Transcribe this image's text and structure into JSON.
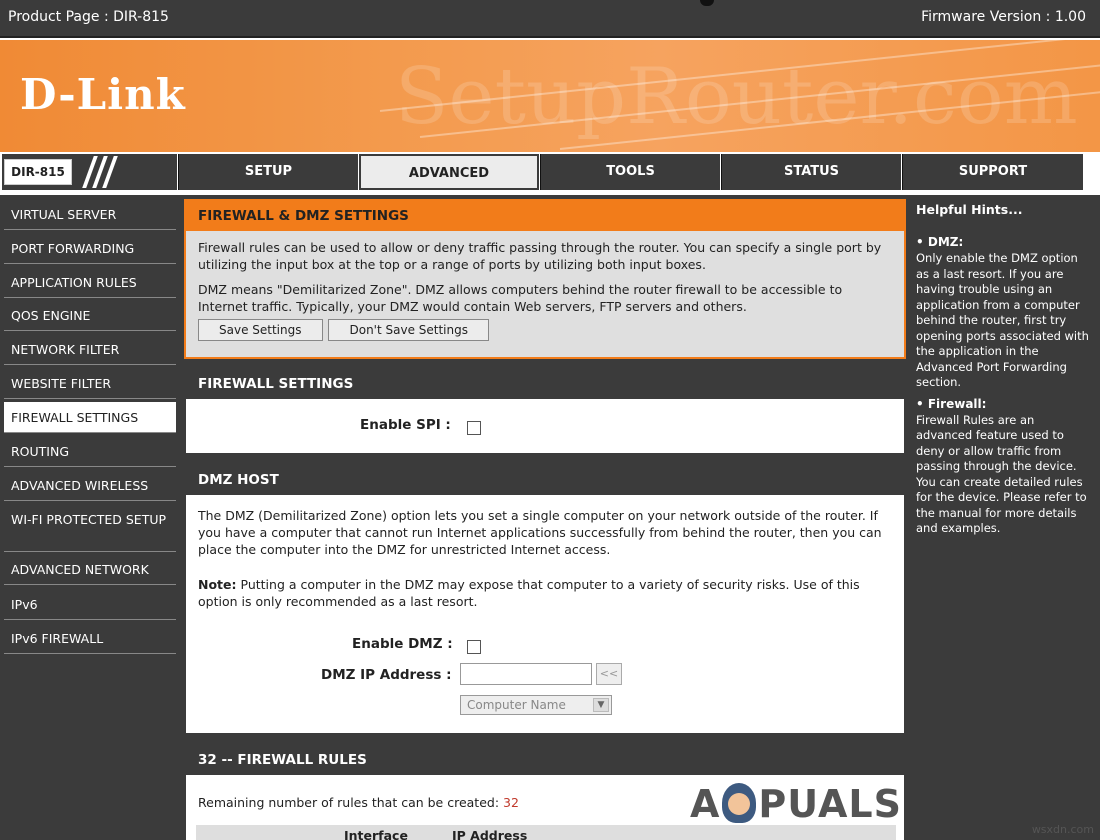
{
  "topbar": {
    "product": "Product Page : DIR-815",
    "firmware": "Firmware Version : 1.00"
  },
  "banner": {
    "logo": "D-Link",
    "watermark": "SetupRouter.com"
  },
  "model": "DIR-815",
  "nav": [
    {
      "label": "SETUP",
      "active": false
    },
    {
      "label": "ADVANCED",
      "active": true
    },
    {
      "label": "TOOLS",
      "active": false
    },
    {
      "label": "STATUS",
      "active": false
    },
    {
      "label": "SUPPORT",
      "active": false
    }
  ],
  "sidebar": {
    "items": [
      {
        "label": "VIRTUAL SERVER"
      },
      {
        "label": "PORT FORWARDING"
      },
      {
        "label": "APPLICATION RULES"
      },
      {
        "label": "QOS ENGINE"
      },
      {
        "label": "NETWORK FILTER"
      },
      {
        "label": "WEBSITE FILTER"
      },
      {
        "label": "FIREWALL SETTINGS",
        "active": true
      },
      {
        "label": "ROUTING"
      },
      {
        "label": "ADVANCED WIRELESS"
      },
      {
        "label": "WI-FI PROTECTED SETUP"
      },
      {
        "label": "ADVANCED NETWORK"
      },
      {
        "label": "IPv6"
      },
      {
        "label": "IPv6 FIREWALL"
      }
    ]
  },
  "intro": {
    "title": "FIREWALL & DMZ SETTINGS",
    "text1": "Firewall rules can be used to allow or deny traffic passing through the router. You can specify a single port by utilizing the input box at the top or a range of ports by utilizing both input boxes.",
    "text2": "DMZ means \"Demilitarized Zone\". DMZ allows computers behind the router firewall to be accessible to Internet traffic. Typically, your DMZ would contain Web servers, FTP servers and others.",
    "save_label": "Save Settings",
    "dont_save_label": "Don't Save Settings"
  },
  "firewall": {
    "title": "FIREWALL SETTINGS",
    "spi_label": "Enable SPI :",
    "spi_checked": false
  },
  "dmz": {
    "title": "DMZ HOST",
    "text": "The DMZ (Demilitarized Zone) option lets you set a single computer on your network outside of the router. If you have a computer that cannot run Internet applications successfully from behind the router, then you can place the computer into the DMZ for unrestricted Internet access.",
    "note_label": "Note:",
    "note_text": "Putting a computer in the DMZ may expose that computer to a variety of security risks. Use of this option is only recommended as a last resort.",
    "enable_label": "Enable DMZ :",
    "enable_checked": false,
    "ip_label": "DMZ IP Address :",
    "ip_value": "",
    "copy_label": "<<",
    "computer_name": "Computer Name"
  },
  "rules": {
    "title": "32 -- FIREWALL RULES",
    "remaining_label": "Remaining number of rules that can be created:",
    "remaining_value": "32",
    "col_interface": "Interface",
    "col_ip": "IP Address"
  },
  "hints": {
    "title": "Helpful Hints...",
    "dmz_title": "DMZ:",
    "dmz_text": "Only enable the DMZ option as a last resort. If you are having trouble using an application from a computer behind the router, first try opening ports associated with the application in the Advanced Port Forwarding section.",
    "fw_title": "Firewall:",
    "fw_text": "Firewall Rules are an advanced feature used to deny or allow traffic from passing through the device. You can create detailed rules for the device. Please refer to the manual for more details and examples."
  },
  "watermarks": {
    "appuals_a": "A",
    "appuals_rest": "PUALS",
    "credit": "wsxdn.com"
  }
}
